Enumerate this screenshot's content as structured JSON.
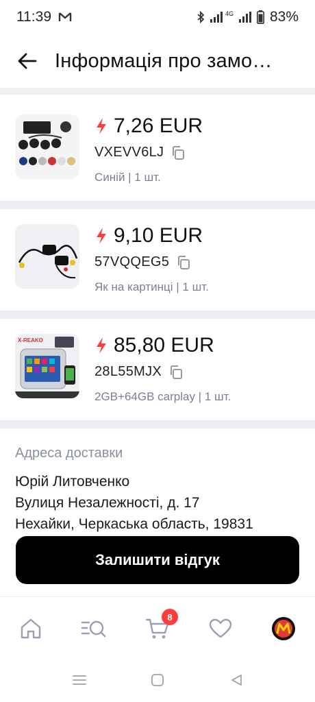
{
  "status_bar": {
    "time": "11:39",
    "battery": "83%",
    "net_label": "4G"
  },
  "header": {
    "title": "Інформація про замо…"
  },
  "items": [
    {
      "price": "7,26 EUR",
      "sku": "VXEVV6LJ",
      "variant": "Синій | 1 шт."
    },
    {
      "price": "9,10 EUR",
      "sku": "57VQQEG5",
      "variant": "Як на картинці | 1 шт."
    },
    {
      "price": "85,80 EUR",
      "sku": "28L55MJX",
      "variant": "2GB+64GB carplay | 1 шт."
    }
  ],
  "delivery": {
    "label": "Адреса доставки",
    "name": "Юрій Литовченко",
    "street": "Вулиця Незалежності, д. 17",
    "city": "Нехайки, Черкаська область, 19831"
  },
  "review_button": "Залишити відгук",
  "tabbar": {
    "cart_badge": "8"
  },
  "colors": {
    "accent": "#ff3d3d",
    "muted": "#7a7f99",
    "button_bg": "#000000"
  },
  "thumb_text": {
    "item3_brand": "X-REAKO"
  }
}
